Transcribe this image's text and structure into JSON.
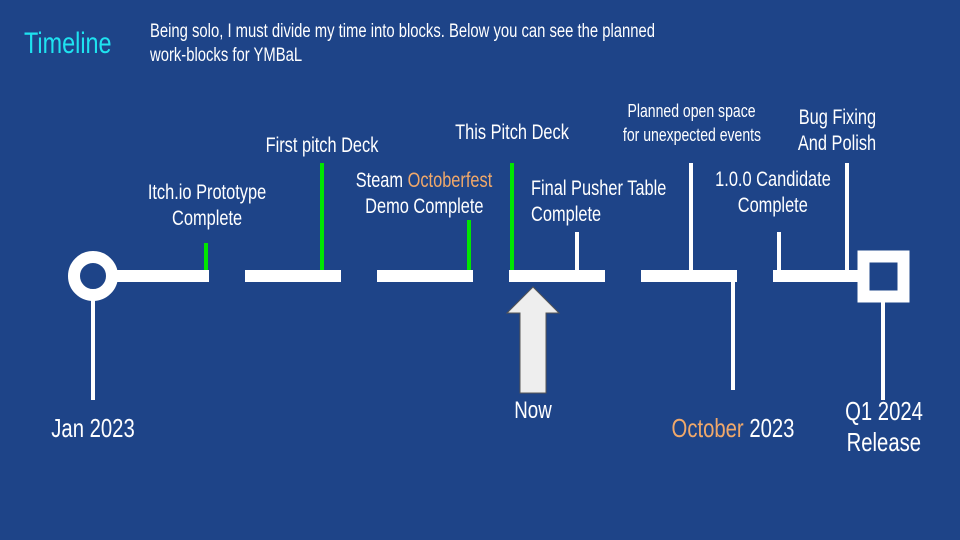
{
  "header": {
    "title": "Timeline",
    "subtitle_line1": "Being solo, I must divide my time into blocks. Below you can see the planned",
    "subtitle_line2": "work-blocks for YMBaL"
  },
  "colors": {
    "background": "#1e4488",
    "title": "#1ee3f0",
    "text": "#ffffff",
    "highlight": "#f0a86a",
    "completed_marker": "#00e600",
    "pending_marker": "#ffffff",
    "now_arrow": "#eeeeee"
  },
  "milestones": [
    {
      "line1": "Itch.io Prototype",
      "line2": "Complete",
      "status": "completed"
    },
    {
      "line1": "First pitch Deck",
      "status": "completed"
    },
    {
      "line1_prefix": "Steam ",
      "line1_highlight": "Octoberfest",
      "line2": "Demo Complete",
      "status": "completed"
    },
    {
      "line1": "This Pitch Deck",
      "status": "completed"
    },
    {
      "line1": "Final Pusher Table",
      "line2": "Complete",
      "status": "planned"
    },
    {
      "line1": "Planned open space",
      "line2": "for unexpected events",
      "status": "planned"
    },
    {
      "line1": "1.0.0 Candidate",
      "line2": "Complete",
      "status": "planned"
    },
    {
      "line1": "Bug Fixing",
      "line2": "And Polish",
      "status": "planned"
    }
  ],
  "dates": {
    "start": "Jan 2023",
    "now": "Now",
    "october_highlight": "October",
    "october_year": " 2023",
    "end_line1": "Q1 2024",
    "end_line2": "Release"
  }
}
